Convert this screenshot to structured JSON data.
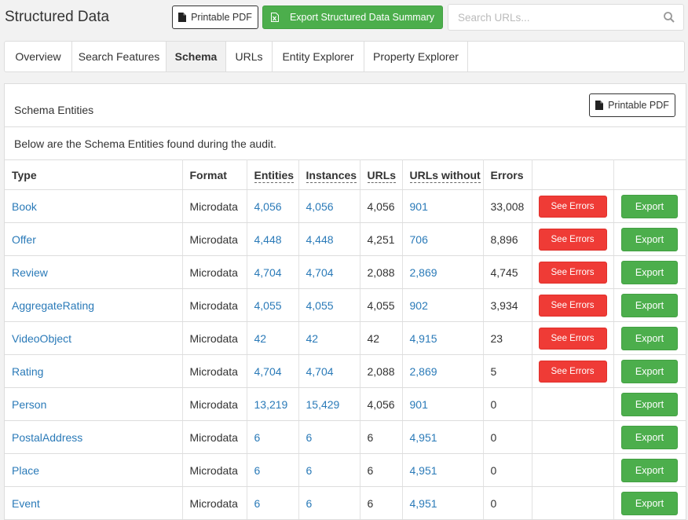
{
  "header": {
    "title": "Structured Data",
    "printable_pdf_label": "Printable PDF",
    "export_summary_label": "Export Structured Data Summary",
    "search_placeholder": "Search URLs..."
  },
  "tabs": [
    {
      "label": "Overview",
      "active": false
    },
    {
      "label": "Search Features",
      "active": false
    },
    {
      "label": "Schema",
      "active": true
    },
    {
      "label": "URLs",
      "active": false
    },
    {
      "label": "Entity Explorer",
      "active": false
    },
    {
      "label": "Property Explorer",
      "active": false
    }
  ],
  "panel": {
    "title": "Schema Entities",
    "printable_pdf_label": "Printable PDF",
    "description": "Below are the Schema Entities found during the audit."
  },
  "table": {
    "columns": [
      "Type",
      "Format",
      "Entities",
      "Instances",
      "URLs",
      "URLs without",
      "Errors"
    ],
    "see_errors_label": "See Errors",
    "export_label": "Export",
    "rows": [
      {
        "type": "Book",
        "format": "Microdata",
        "entities": "4,056",
        "instances": "4,056",
        "urls": "4,056",
        "urls_without": "901",
        "errors": "33,008",
        "has_errors": true
      },
      {
        "type": "Offer",
        "format": "Microdata",
        "entities": "4,448",
        "instances": "4,448",
        "urls": "4,251",
        "urls_without": "706",
        "errors": "8,896",
        "has_errors": true
      },
      {
        "type": "Review",
        "format": "Microdata",
        "entities": "4,704",
        "instances": "4,704",
        "urls": "2,088",
        "urls_without": "2,869",
        "errors": "4,745",
        "has_errors": true
      },
      {
        "type": "AggregateRating",
        "format": "Microdata",
        "entities": "4,055",
        "instances": "4,055",
        "urls": "4,055",
        "urls_without": "902",
        "errors": "3,934",
        "has_errors": true
      },
      {
        "type": "VideoObject",
        "format": "Microdata",
        "entities": "42",
        "instances": "42",
        "urls": "42",
        "urls_without": "4,915",
        "errors": "23",
        "has_errors": true
      },
      {
        "type": "Rating",
        "format": "Microdata",
        "entities": "4,704",
        "instances": "4,704",
        "urls": "2,088",
        "urls_without": "2,869",
        "errors": "5",
        "has_errors": true
      },
      {
        "type": "Person",
        "format": "Microdata",
        "entities": "13,219",
        "instances": "15,429",
        "urls": "4,056",
        "urls_without": "901",
        "errors": "0",
        "has_errors": false
      },
      {
        "type": "PostalAddress",
        "format": "Microdata",
        "entities": "6",
        "instances": "6",
        "urls": "6",
        "urls_without": "4,951",
        "errors": "0",
        "has_errors": false
      },
      {
        "type": "Place",
        "format": "Microdata",
        "entities": "6",
        "instances": "6",
        "urls": "6",
        "urls_without": "4,951",
        "errors": "0",
        "has_errors": false
      },
      {
        "type": "Event",
        "format": "Microdata",
        "entities": "6",
        "instances": "6",
        "urls": "6",
        "urls_without": "4,951",
        "errors": "0",
        "has_errors": false
      }
    ]
  },
  "icons": {
    "pdf": "file-icon",
    "excel": "excel-file-icon",
    "search": "search-icon"
  },
  "colors": {
    "link": "#2a7ab8",
    "green": "#4cae4c",
    "red": "#ef3b36"
  }
}
